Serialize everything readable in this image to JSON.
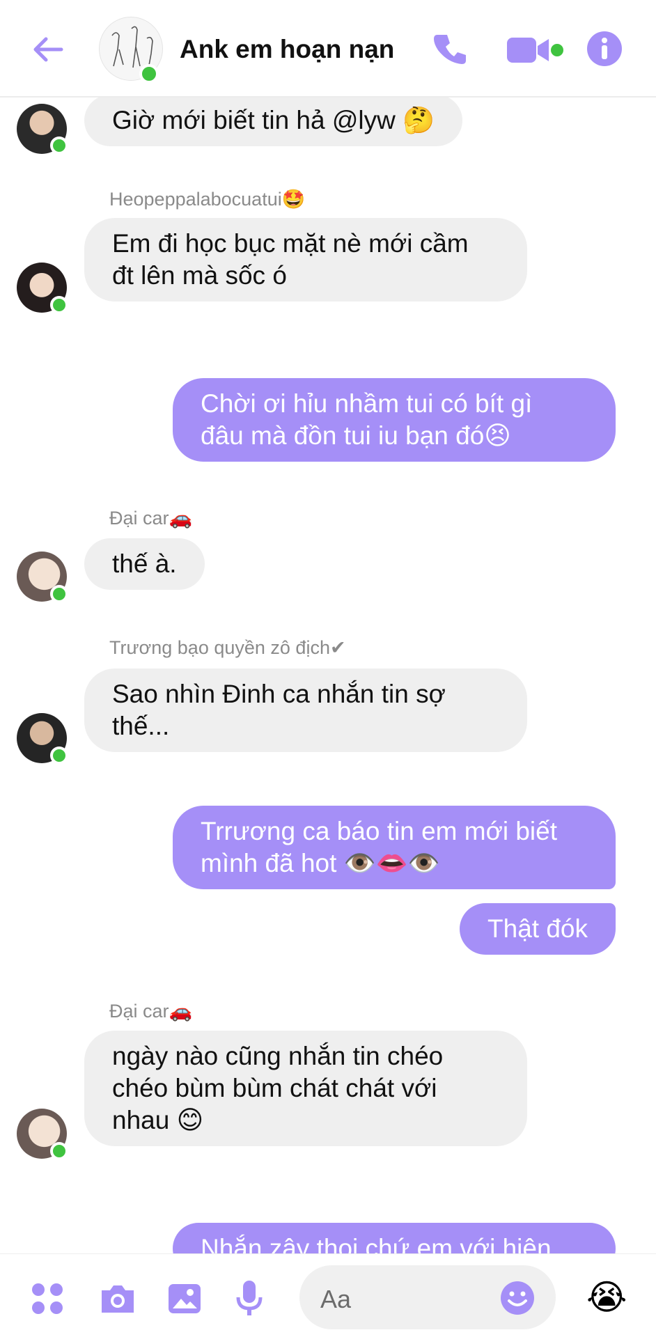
{
  "header": {
    "title": "Ank em hoạn nạn",
    "back_icon": "arrow-left-icon",
    "call_icon": "phone-icon",
    "video_icon": "video-camera-icon",
    "info_icon": "info-icon",
    "accent": "#a58ff7"
  },
  "messages": [
    {
      "text": "Giờ mới biết tin hả @lyw 🤔"
    },
    {
      "sender": "Heopeppalabocuatui🤩",
      "text_lines": [
        "Em đi học bục mặt nè mới cầm",
        "đt lên mà sốc ó"
      ]
    },
    {
      "text_lines": [
        "Chời ơi hỉu nhầm tui có bít gì",
        "đâu mà đồn tui iu bạn đó😣"
      ]
    },
    {
      "sender": "Đại car🚗",
      "text": "thế à."
    },
    {
      "sender": "Trương bạo quyền zô địch✔",
      "text_lines": [
        "Sao nhìn Đinh ca nhắn tin sợ",
        "thế..."
      ]
    },
    {
      "text_lines": [
        "Trrương ca báo tin em mới biết",
        "mình đã hot 👁️👄👁️"
      ]
    },
    {
      "text": "Thật đók"
    },
    {
      "sender": "Đại car🚗",
      "text_lines": [
        "ngày nào cũng nhắn tin chéo",
        "chéo bùm bùm chát chát với",
        "nhau 😊"
      ]
    },
    {
      "text": "Nhắn zậy thoi chứ em với hiện"
    }
  ],
  "composer": {
    "placeholder": "Aa",
    "menu_icon": "four-dots-icon",
    "camera_icon": "camera-icon",
    "gallery_icon": "image-icon",
    "mic_icon": "microphone-icon",
    "emoji_icon": "smiley-icon",
    "quick_reaction": "😭"
  }
}
